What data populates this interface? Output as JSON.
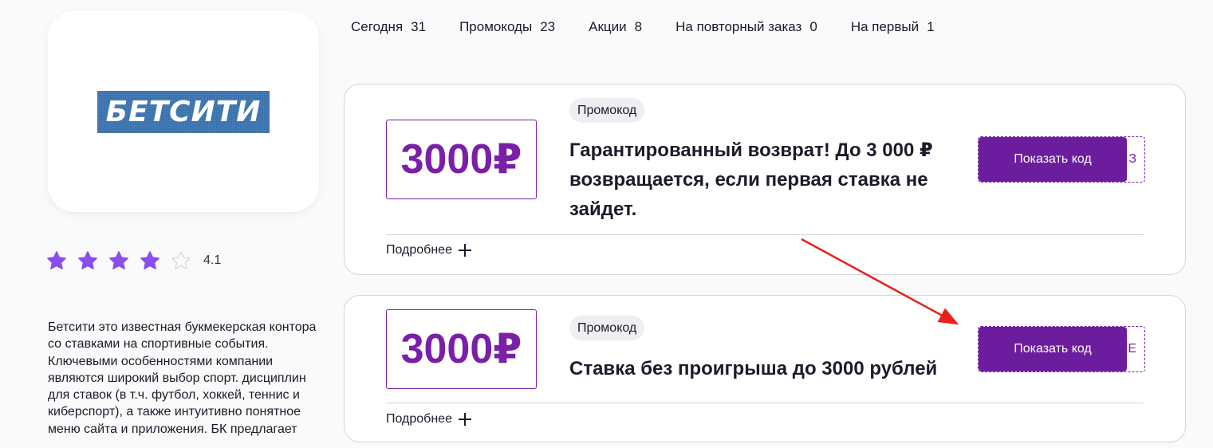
{
  "brand": {
    "logo_text": "БЕТСИТИ"
  },
  "rating": {
    "value": "4.1",
    "stars_filled": 4,
    "stars_total": 5,
    "star_color": "#8b4cf0"
  },
  "description": "Бетсити это известная букмекерская контора со ставками на спортивные события. Ключевыми особенностями компании являются широкий выбор спорт. дисциплин для ставок (в т.ч. футбол, хоккей, теннис и киберспорт), а также интуитивно понятное меню сайта и приложения. БК предлагает",
  "nav": [
    {
      "label": "Сегодня",
      "count": "31"
    },
    {
      "label": "Промокоды",
      "count": "23"
    },
    {
      "label": "Акции",
      "count": "8"
    },
    {
      "label": "На повторный заказ",
      "count": "0"
    },
    {
      "label": "На первый",
      "count": "1"
    }
  ],
  "offers": [
    {
      "amount": "3000₽",
      "tag": "Промокод",
      "title": "Гарантированный возврат! До 3 000 ₽ возвращается, если первая ставка не зайдет.",
      "button": "Показать код",
      "code_peek": "З",
      "details": "Подробнее"
    },
    {
      "amount": "3000₽",
      "tag": "Промокод",
      "title": "Ставка без проигрыша до 3000 рублей",
      "button": "Показать код",
      "code_peek": "YE",
      "details": "Подробнее"
    }
  ],
  "colors": {
    "accent": "#6c1d9e",
    "amount": "#7a20a8",
    "logo_bg": "#3a72ad",
    "annotation_arrow": "#e8201c"
  }
}
